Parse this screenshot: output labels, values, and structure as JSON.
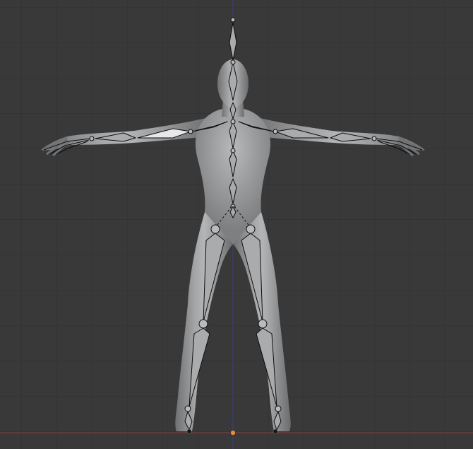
{
  "viewport": {
    "view": "front-orthographic",
    "background_color": "#393939",
    "grid_color": "#2f2f2f",
    "x_axis_color": "#8a3b3b",
    "z_axis_color": "#3b3b8a",
    "object_origin_color": "#e88a3c",
    "mesh_color": "#8e9092",
    "bone_color": "#a9abad",
    "bone_highlight_color": "#e8e8ea"
  },
  "objects": {
    "mesh": "humanoid-body-mesh",
    "armature": "humanoid-armature"
  }
}
